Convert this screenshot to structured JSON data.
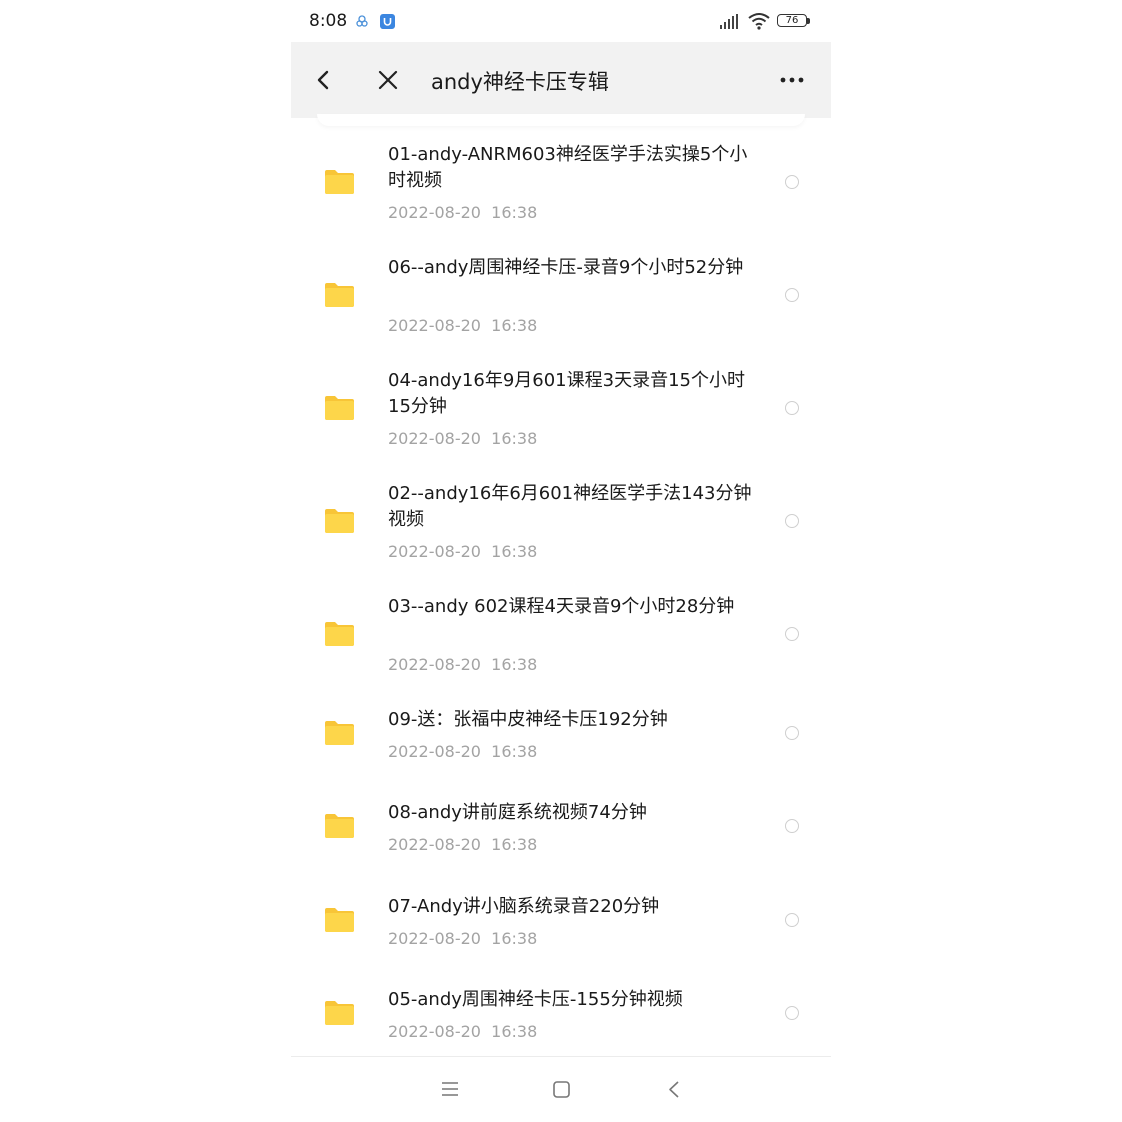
{
  "status_bar": {
    "time": "8:08",
    "battery": "76"
  },
  "header": {
    "title": "andy神经卡压专辑",
    "back_icon": "chevron-left-icon",
    "close_icon": "close-icon",
    "more_icon": "more-horizontal-icon"
  },
  "colors": {
    "folder": "#fdd64a",
    "folder_back": "#f8c537",
    "header_bg": "#f2f2f2",
    "date_text": "#a3a3a3"
  },
  "files": [
    {
      "name": "01-andy-ANRM603神经医学手法实操5个小时视频",
      "date": "2022-08-20  16:38"
    },
    {
      "name": "06--andy周围神经卡压-录音9个小时52分钟",
      "date": "2022-08-20  16:38"
    },
    {
      "name": "04-andy16年9月601课程3天录音15个小时15分钟",
      "date": "2022-08-20  16:38"
    },
    {
      "name": "02--andy16年6月601神经医学手法143分钟视频",
      "date": "2022-08-20  16:38"
    },
    {
      "name": "03--andy 602课程4天录音9个小时28分钟",
      "date": "2022-08-20  16:38"
    },
    {
      "name": "09-送：张福中皮神经卡压192分钟",
      "date": "2022-08-20  16:38"
    },
    {
      "name": "08-andy讲前庭系统视频74分钟",
      "date": "2022-08-20  16:38"
    },
    {
      "name": "07-Andy讲小脑系统录音220分钟",
      "date": "2022-08-20  16:38"
    },
    {
      "name": "05-andy周围神经卡压-155分钟视频",
      "date": "2022-08-20  16:38"
    }
  ],
  "nav_bar": {
    "menu_icon": "menu-icon",
    "home_icon": "home-square-icon",
    "back_icon": "back-triangle-icon"
  }
}
